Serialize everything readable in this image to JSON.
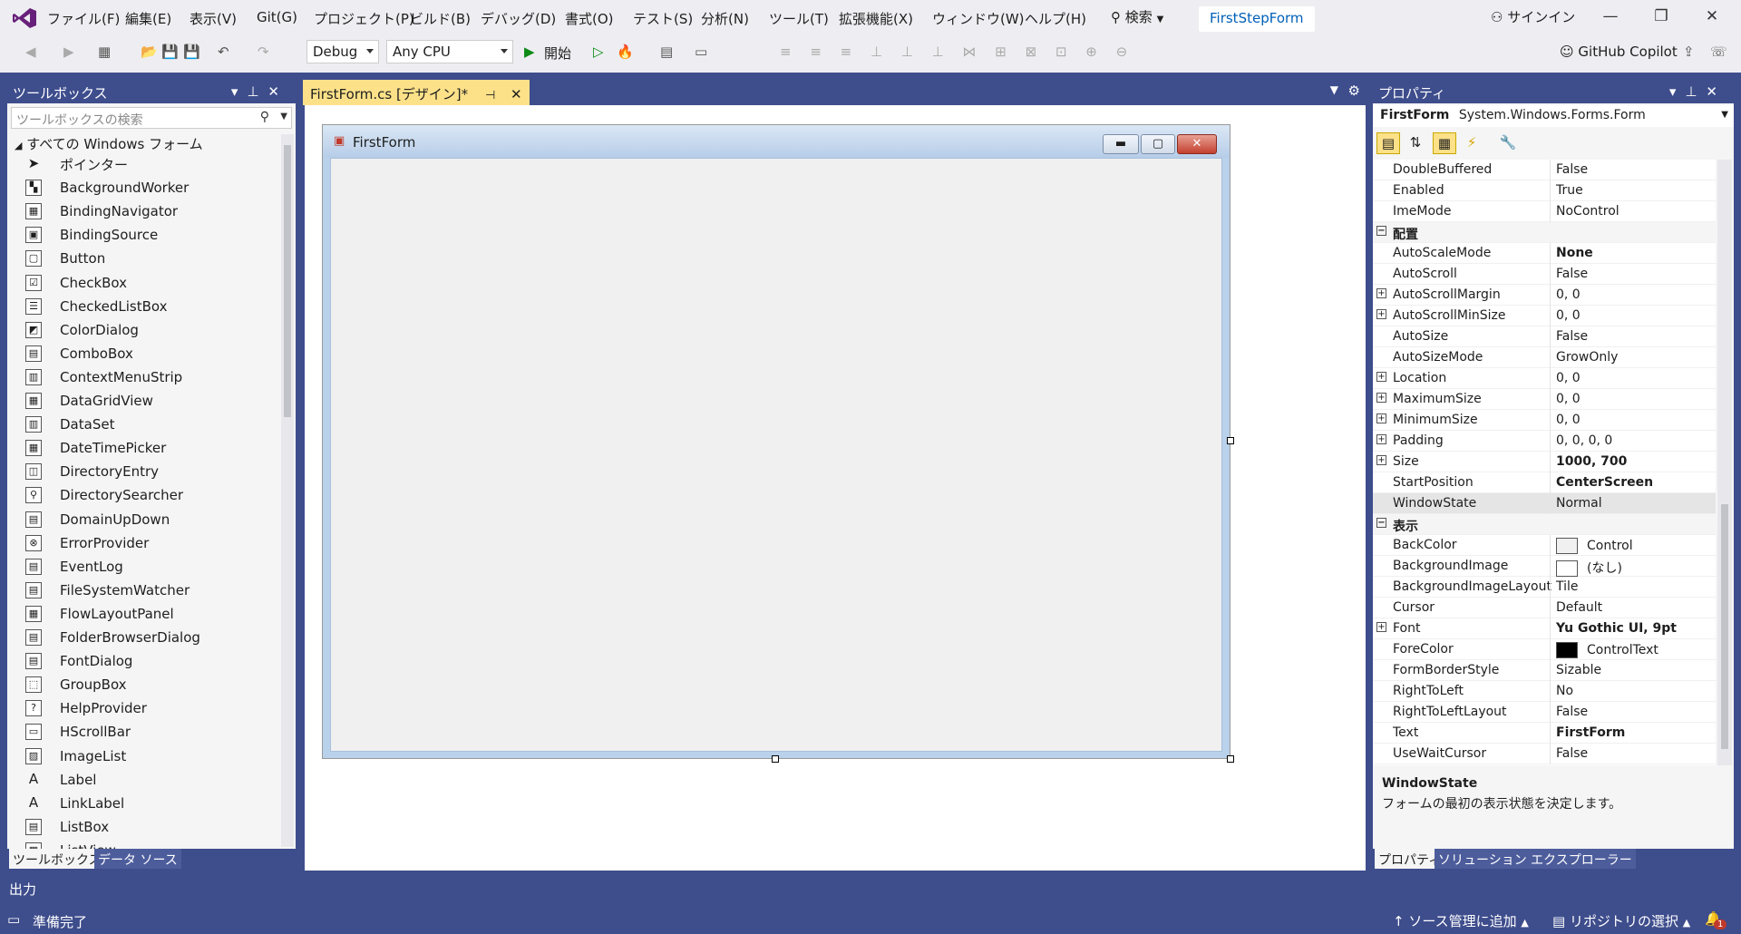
{
  "menu": [
    "ファイル(F)",
    "編集(E)",
    "表示(V)",
    "Git(G)",
    "プロジェクト(P)",
    "ビルド(B)",
    "デバッグ(D)",
    "書式(O)",
    "テスト(S)",
    "分析(N)",
    "ツール(T)",
    "拡張機能(X)",
    "ウィンドウ(W)",
    "ヘルプ(H)"
  ],
  "search_label": "検索",
  "solution_name": "FirstStepForm",
  "signin": "サインイン",
  "toolbar": {
    "config": "Debug",
    "platform": "Any CPU",
    "start": "開始",
    "copilot": "GitHub Copilot"
  },
  "toolbox": {
    "title": "ツールボックス",
    "search_placeholder": "ツールボックスの検索",
    "category": "すべての Windows フォーム",
    "items": [
      "ポインター",
      "BackgroundWorker",
      "BindingNavigator",
      "BindingSource",
      "Button",
      "CheckBox",
      "CheckedListBox",
      "ColorDialog",
      "ComboBox",
      "ContextMenuStrip",
      "DataGridView",
      "DataSet",
      "DateTimePicker",
      "DirectoryEntry",
      "DirectorySearcher",
      "DomainUpDown",
      "ErrorProvider",
      "EventLog",
      "FileSystemWatcher",
      "FlowLayoutPanel",
      "FolderBrowserDialog",
      "FontDialog",
      "GroupBox",
      "HelpProvider",
      "HScrollBar",
      "ImageList",
      "Label",
      "LinkLabel",
      "ListBox",
      "ListView"
    ],
    "tabs": [
      "ツールボックス",
      "データ ソース"
    ]
  },
  "doc_tab": "FirstForm.cs [デザイン]*",
  "form": {
    "title": "FirstForm"
  },
  "properties": {
    "title": "プロパティ",
    "selected_object": "FirstForm",
    "selected_type": "System.Windows.Forms.Form",
    "rows": [
      {
        "name": "DoubleBuffered",
        "value": "False"
      },
      {
        "name": "Enabled",
        "value": "True"
      },
      {
        "name": "ImeMode",
        "value": "NoControl"
      },
      {
        "name": "配置",
        "value": "",
        "category": true
      },
      {
        "name": "AutoScaleMode",
        "value": "None",
        "bold": true
      },
      {
        "name": "AutoScroll",
        "value": "False"
      },
      {
        "name": "AutoScrollMargin",
        "value": "0, 0",
        "expand": true
      },
      {
        "name": "AutoScrollMinSize",
        "value": "0, 0",
        "expand": true
      },
      {
        "name": "AutoSize",
        "value": "False"
      },
      {
        "name": "AutoSizeMode",
        "value": "GrowOnly"
      },
      {
        "name": "Location",
        "value": "0, 0",
        "expand": true
      },
      {
        "name": "MaximumSize",
        "value": "0, 0",
        "expand": true
      },
      {
        "name": "MinimumSize",
        "value": "0, 0",
        "expand": true
      },
      {
        "name": "Padding",
        "value": "0, 0, 0, 0",
        "expand": true
      },
      {
        "name": "Size",
        "value": "1000, 700",
        "expand": true,
        "bold": true
      },
      {
        "name": "StartPosition",
        "value": "CenterScreen",
        "bold": true
      },
      {
        "name": "WindowState",
        "value": "Normal"
      },
      {
        "name": "表示",
        "value": "",
        "category": true
      },
      {
        "name": "BackColor",
        "value": "Control",
        "swatch": "#f0f0f0"
      },
      {
        "name": "BackgroundImage",
        "value": "(なし)",
        "swatch": "#ffffff"
      },
      {
        "name": "BackgroundImageLayout",
        "value": "Tile"
      },
      {
        "name": "Cursor",
        "value": "Default"
      },
      {
        "name": "Font",
        "value": "Yu Gothic UI, 9pt",
        "expand": true,
        "bold": true
      },
      {
        "name": "ForeColor",
        "value": "ControlText",
        "swatch": "#000000"
      },
      {
        "name": "FormBorderStyle",
        "value": "Sizable"
      },
      {
        "name": "RightToLeft",
        "value": "No"
      },
      {
        "name": "RightToLeftLayout",
        "value": "False"
      },
      {
        "name": "Text",
        "value": "FirstForm",
        "bold": true
      },
      {
        "name": "UseWaitCursor",
        "value": "False"
      }
    ],
    "desc_title": "WindowState",
    "desc_text": "フォームの最初の表示状態を決定します。",
    "tabs": [
      "プロパティ",
      "ソリューション エクスプローラー"
    ]
  },
  "output_label": "出力",
  "status": {
    "ready": "準備完了",
    "source_control": "ソース管理に追加",
    "repo": "リポジトリの選択",
    "notifications": "1"
  },
  "colors": {
    "accent": "#3e4d8c",
    "doc_tab": "#fce189",
    "vs_purple": "#68217a"
  }
}
